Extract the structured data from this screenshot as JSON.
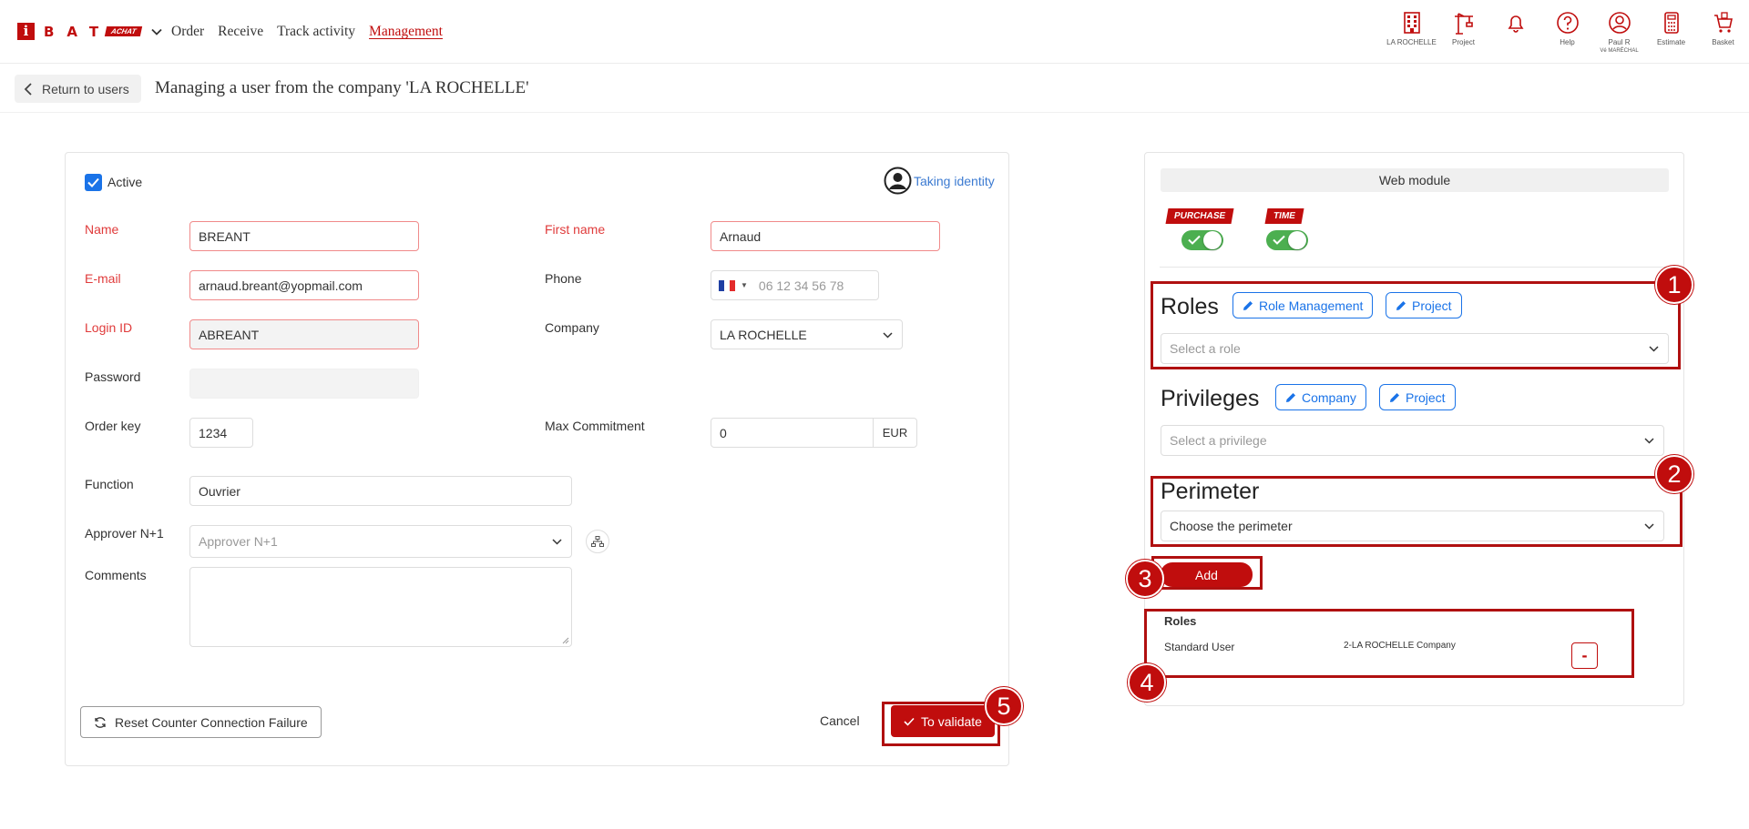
{
  "header": {
    "logo_letter": "i",
    "logo_letters": "BAT",
    "logo_tag": "ACHAT",
    "nav": [
      {
        "label": "Order"
      },
      {
        "label": "Receive"
      },
      {
        "label": "Track activity"
      },
      {
        "label": "Management"
      }
    ],
    "tools": [
      {
        "label": "LA ROCHELLE",
        "icon": "building-icon"
      },
      {
        "label": "Project",
        "icon": "crane-icon"
      },
      {
        "label": "",
        "icon": "bell-icon"
      },
      {
        "label": "Help",
        "icon": "help-icon"
      },
      {
        "label": "Paul R",
        "sublabel": "Vé MARÉCHAL",
        "icon": "user-icon"
      },
      {
        "label": "Estimate",
        "icon": "calculator-icon"
      },
      {
        "label": "Basket",
        "icon": "basket-icon"
      }
    ]
  },
  "subheader": {
    "return_label": "Return to users",
    "title": "Managing a user from the company 'LA ROCHELLE'"
  },
  "form": {
    "active_label": "Active",
    "taking_identity": "Taking identity",
    "name_label": "Name",
    "name_value": "BREANT",
    "firstname_label": "First name",
    "firstname_value": "Arnaud",
    "email_label": "E-mail",
    "email_value": "arnaud.breant@yopmail.com",
    "phone_label": "Phone",
    "phone_placeholder": "06 12 34 56 78",
    "login_label": "Login ID",
    "login_value": "ABREANT",
    "company_label": "Company",
    "company_value": "LA ROCHELLE",
    "password_label": "Password",
    "orderkey_label": "Order key",
    "orderkey_value": "1234",
    "maxcommit_label": "Max Commitment",
    "maxcommit_value": "0",
    "currency": "EUR",
    "function_label": "Function",
    "function_value": "Ouvrier",
    "approver_label": "Approver N+1",
    "approver_placeholder": "Approver N+1",
    "comments_label": "Comments",
    "reset_label": "Reset Counter Connection Failure",
    "cancel_label": "Cancel",
    "validate_label": "To validate"
  },
  "rights": {
    "web_module": "Web module",
    "badges": [
      "PURCHASE",
      "TIME"
    ],
    "roles_title": "Roles",
    "role_mgmt_label": "Role Management",
    "project_label": "Project",
    "role_placeholder": "Select a role",
    "privileges_title": "Privileges",
    "company_label": "Company",
    "privilege_placeholder": "Select a privilege",
    "perimeter_title": "Perimeter",
    "perimeter_placeholder": "Choose the perimeter",
    "add_label": "Add",
    "table_title": "Roles",
    "table_rows": [
      {
        "role": "Standard User",
        "scope": "2-LA ROCHELLE Company",
        "action": "-"
      }
    ]
  },
  "callouts": [
    "1",
    "2",
    "3",
    "4",
    "5"
  ],
  "colors": {
    "brand": "#c00d0d",
    "link": "#1a73e8",
    "toggle_on": "#4caf50"
  }
}
